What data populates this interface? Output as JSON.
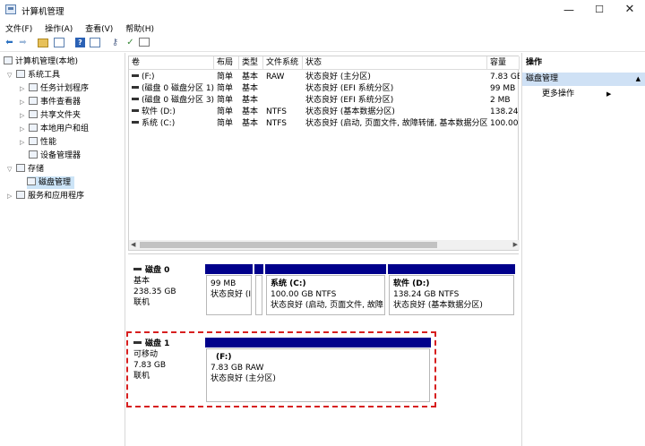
{
  "window": {
    "title": "计算机管理",
    "min_glyph": "—",
    "max_glyph": "☐",
    "close_glyph": "✕"
  },
  "menu": [
    "文件(F)",
    "操作(A)",
    "查看(V)",
    "帮助(H)"
  ],
  "tree": {
    "root": "计算机管理(本地)",
    "system_tools": "系统工具",
    "task_scheduler": "任务计划程序",
    "event_viewer": "事件查看器",
    "shared_folders": "共享文件夹",
    "local_users": "本地用户和组",
    "performance": "性能",
    "device_manager": "设备管理器",
    "storage": "存储",
    "disk_management": "磁盘管理",
    "services": "服务和应用程序"
  },
  "volume_list": {
    "columns": [
      "卷",
      "布局",
      "类型",
      "文件系统",
      "状态",
      "容量"
    ],
    "rows": [
      {
        "vol": "(F:)",
        "layout": "简单",
        "type": "基本",
        "fs": "RAW",
        "status": "状态良好 (主分区)",
        "cap": "7.83 GB"
      },
      {
        "vol": "(磁盘 0 磁盘分区 1)",
        "layout": "简单",
        "type": "基本",
        "fs": "",
        "status": "状态良好 (EFI 系统分区)",
        "cap": "99 MB"
      },
      {
        "vol": "(磁盘 0 磁盘分区 3)",
        "layout": "简单",
        "type": "基本",
        "fs": "",
        "status": "状态良好 (EFI 系统分区)",
        "cap": "2 MB"
      },
      {
        "vol": "软件 (D:)",
        "layout": "简单",
        "type": "基本",
        "fs": "NTFS",
        "status": "状态良好 (基本数据分区)",
        "cap": "138.24"
      },
      {
        "vol": "系统 (C:)",
        "layout": "简单",
        "type": "基本",
        "fs": "NTFS",
        "status": "状态良好 (启动, 页面文件, 故障转储, 基本数据分区)",
        "cap": "100.00"
      }
    ]
  },
  "disk0": {
    "name": "磁盘 0",
    "kind": "基本",
    "size": "238.35 GB",
    "state": "联机",
    "partitions": [
      {
        "name": "",
        "size": "99 MB",
        "status": "状态良好 (I"
      },
      {
        "name": "",
        "size": "",
        "status": ""
      },
      {
        "name": "系统  (C:)",
        "size": "100.00 GB NTFS",
        "status": "状态良好 (启动, 页面文件, 故障"
      },
      {
        "name": "软件  (D:)",
        "size": "138.24 GB NTFS",
        "status": "状态良好 (基本数据分区)"
      }
    ]
  },
  "disk1": {
    "name": "磁盘 1",
    "kind": "可移动",
    "size": "7.83 GB",
    "state": "联机",
    "partition": {
      "name": "(F:)",
      "size": "7.83 GB RAW",
      "status": "状态良好 (主分区)"
    }
  },
  "actions": {
    "header": "操作",
    "section": "磁盘管理",
    "more": "更多操作"
  },
  "colors": {
    "partition_bar": "#00008b",
    "highlight": "#d71f1f",
    "selection": "#cce4f7"
  }
}
